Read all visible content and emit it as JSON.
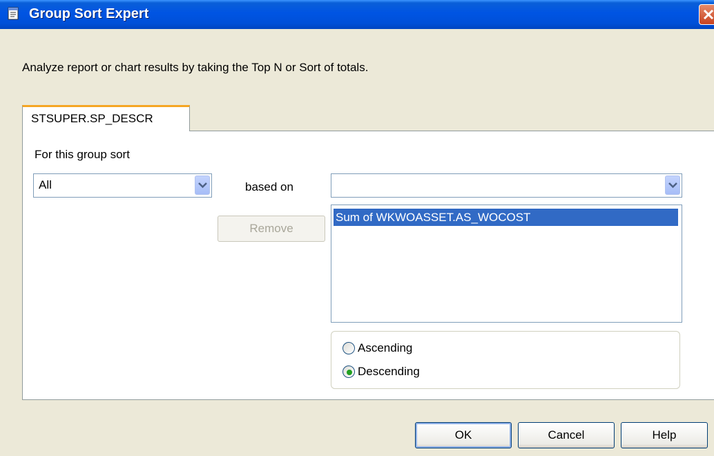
{
  "window": {
    "title": "Group Sort Expert"
  },
  "description": "Analyze report or chart results by taking the Top N or Sort of totals.",
  "tabs": [
    {
      "label": "STSUPER.SP_DESCR",
      "active": true
    }
  ],
  "group_sort": {
    "label": "For this group sort",
    "selected": "All",
    "based_on_label": "based on",
    "based_on_selected": ""
  },
  "remove_button": {
    "label": "Remove",
    "enabled": false
  },
  "sort_list": {
    "items": [
      "Sum of WKWOASSET.AS_WOCOST"
    ],
    "selected_index": 0
  },
  "order": {
    "options": [
      "Ascending",
      "Descending"
    ],
    "selected": "Descending"
  },
  "buttons": {
    "ok": "OK",
    "cancel": "Cancel",
    "help": "Help"
  },
  "colors": {
    "titlebar": "#0054e3",
    "selection": "#316ac5",
    "tab_accent": "#f5a623",
    "dialog_bg": "#ece9d8"
  },
  "icons": {
    "title": "dialog-icon",
    "close": "close-icon",
    "dropdown": "chevron-down-icon"
  }
}
